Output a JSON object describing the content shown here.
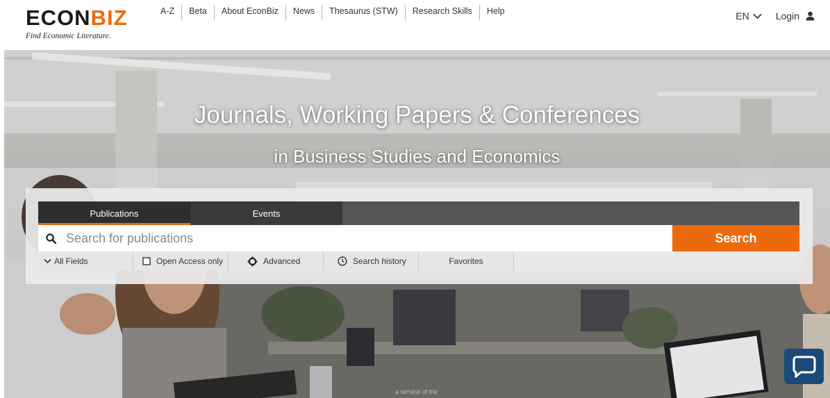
{
  "header": {
    "logo": {
      "wordmark_a": "ECON",
      "wordmark_b": "BIZ",
      "tagline": "Find Economic Literature."
    },
    "nav": [
      {
        "label": "A-Z"
      },
      {
        "label": "Beta"
      },
      {
        "label": "About EconBiz"
      },
      {
        "label": "News"
      },
      {
        "label": "Thesaurus (STW)"
      },
      {
        "label": "Research Skills"
      },
      {
        "label": "Help"
      }
    ],
    "language": {
      "label": "EN",
      "icon": "chevron-down-icon"
    },
    "login": {
      "label": "Login",
      "icon": "user-icon"
    }
  },
  "hero": {
    "title": "Journals, Working Papers & Conferences",
    "subtitle": "in Business Studies and Economics",
    "footer_fragment": "a service of the"
  },
  "search": {
    "tabs": [
      {
        "label": "Publications",
        "active": true
      },
      {
        "label": "Events",
        "active": false
      }
    ],
    "placeholder": "Search for publications",
    "value": "",
    "button_label": "Search",
    "options": {
      "fields_label": "All Fields",
      "open_access_label": "Open Access only",
      "open_access_checked": false,
      "advanced_label": "Advanced",
      "history_label": "Search history",
      "favorites_label": "Favorites"
    }
  },
  "chat": {
    "icon": "chat-bubble-icon"
  },
  "colors": {
    "accent": "#ec6a0c",
    "tab_bar": "#555555",
    "chat": "#1b4a7a"
  }
}
